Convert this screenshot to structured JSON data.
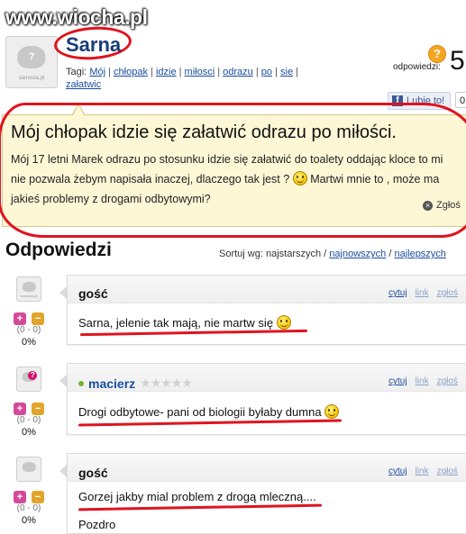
{
  "watermark": "www.wiocha.pl",
  "avatar": {
    "brand": "samosia.pl",
    "mark": "?"
  },
  "question": {
    "author": "Sarna",
    "tags_label": "Tagi:",
    "tags": [
      "Mój",
      "chłopak",
      "idzie",
      "miłosci",
      "odrazu",
      "po",
      "sie",
      "załatwic"
    ],
    "answers_label": "odpowiedzi:",
    "answers_count": "5",
    "like_label": "Lubię to!",
    "like_count": "0",
    "title": "Mój chłopak idzie się załatwić odrazu po miłości.",
    "body_part1": "Mój 17 letni Marek odrazu po stosunku idzie się załatwić do toalety oddając kloce to mi nie pozwala żebym napisała inaczej, dlaczego tak jest ?",
    "body_part2": "Martwi mnie to , może ma jakieś problemy z drogami odbytowymi?",
    "report_label": "Zgłoś"
  },
  "answers_section": {
    "title": "Odpowiedzi",
    "sort_label": "Sortuj wg: najstarszych /",
    "sort_newest": "najnowszych",
    "sort_sep": "/",
    "sort_best": "najlepszych"
  },
  "answer_actions": {
    "quote": "cytuj",
    "link": "link",
    "report": "zgłoś"
  },
  "answers": [
    {
      "author": "gość",
      "text": "Sarna, jelenie tak mają, nie martw się",
      "score": "(0 - 0)",
      "percent": "0%"
    },
    {
      "author": "macierz",
      "text": "Drogi odbytowe- pani od biologii byłaby dumna",
      "score": "(0 - 0)",
      "percent": "0%",
      "rating_stars": 5
    },
    {
      "author": "gość",
      "text": "Gorzej jakby mial problem z drogą mleczną....",
      "text2": "Pozdro",
      "score": "(0 - 0)",
      "percent": "0%"
    }
  ],
  "colors": {
    "highlight_red": "#e0131e",
    "link_blue": "#1a4d9e",
    "question_bg": "#fdf7d6"
  }
}
